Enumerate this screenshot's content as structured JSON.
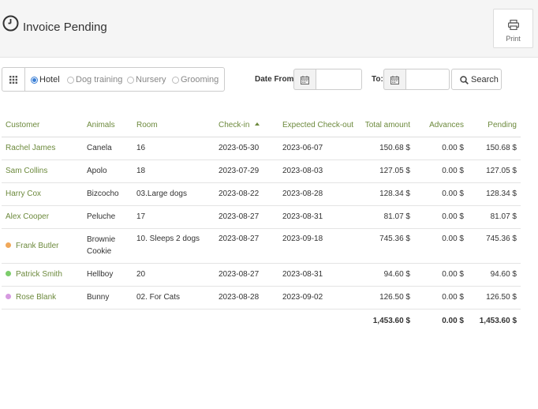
{
  "header": {
    "title": "Invoice Pending",
    "print_label": "Print"
  },
  "filters": {
    "options": [
      "Hotel",
      "Dog training",
      "Nursery",
      "Grooming"
    ],
    "selected": "Hotel",
    "date_from_label": "Date From:",
    "date_from_value": "",
    "date_to_label": "To:",
    "date_to_value": "",
    "search_label": "Search"
  },
  "table": {
    "headers": [
      "Customer",
      "Animals",
      "Room",
      "Check-in",
      "Expected Check-out",
      "Total amount",
      "Advances",
      "Pending"
    ],
    "sorted_by": "Check-in",
    "rows": [
      {
        "customer": "Rachel James",
        "dot_color": "",
        "animals": "Canela",
        "room": "16",
        "checkin": "2023-05-30",
        "checkout": "2023-06-07",
        "total": "150.68 $",
        "advances": "0.00 $",
        "pending": "150.68 $"
      },
      {
        "customer": "Sam Collins",
        "dot_color": "",
        "animals": "Apolo",
        "room": "18",
        "checkin": "2023-07-29",
        "checkout": "2023-08-03",
        "total": "127.05 $",
        "advances": "0.00 $",
        "pending": "127.05 $"
      },
      {
        "customer": "Harry Cox",
        "dot_color": "",
        "animals": "Bizcocho",
        "room": "03.Large dogs",
        "checkin": "2023-08-22",
        "checkout": "2023-08-28",
        "total": "128.34 $",
        "advances": "0.00 $",
        "pending": "128.34 $"
      },
      {
        "customer": "Alex Cooper",
        "dot_color": "",
        "animals": "Peluche",
        "room": "17",
        "checkin": "2023-08-27",
        "checkout": "2023-08-31",
        "total": "81.07 $",
        "advances": "0.00 $",
        "pending": "81.07 $"
      },
      {
        "customer": "Frank Butler",
        "dot_color": "#f0a85a",
        "animals": "Brownie Cookie",
        "room": "10. Sleeps 2 dogs",
        "checkin": "2023-08-27",
        "checkout": "2023-09-18",
        "total": "745.36 $",
        "advances": "0.00 $",
        "pending": "745.36 $"
      },
      {
        "customer": "Patrick Smith",
        "dot_color": "#7ccd6b",
        "animals": "Hellboy",
        "room": "20",
        "checkin": "2023-08-27",
        "checkout": "2023-08-31",
        "total": "94.60 $",
        "advances": "0.00 $",
        "pending": "94.60 $"
      },
      {
        "customer": "Rose Blank",
        "dot_color": "#d69ae0",
        "animals": "Bunny",
        "room": "02. For Cats",
        "checkin": "2023-08-28",
        "checkout": "2023-09-02",
        "total": "126.50 $",
        "advances": "0.00 $",
        "pending": "126.50 $"
      }
    ],
    "totals": {
      "total": "1,453.60 $",
      "advances": "0.00 $",
      "pending": "1,453.60 $"
    }
  },
  "colors": {
    "accent_green": "#6d8a3d",
    "radio_blue": "#3a7fd5"
  }
}
